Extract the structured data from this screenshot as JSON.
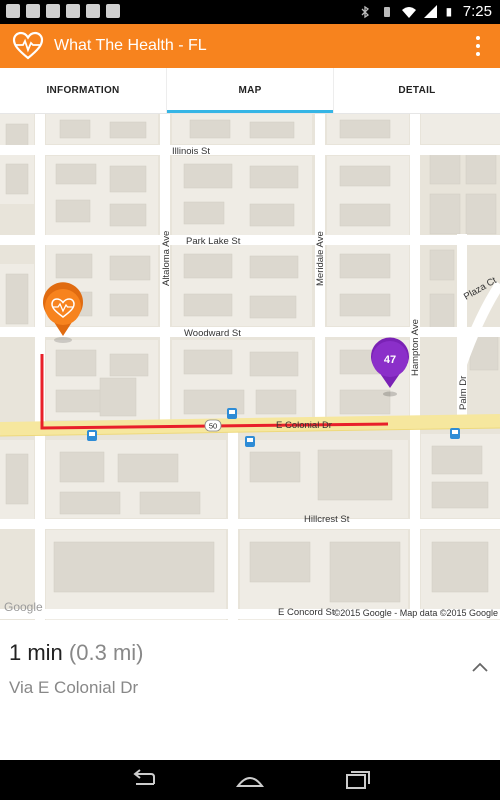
{
  "status_bar": {
    "time": "7:25"
  },
  "app_bar": {
    "title": "What The Health - FL"
  },
  "tabs": [
    {
      "label": "INFORMATION",
      "active": false
    },
    {
      "label": "MAP",
      "active": true
    },
    {
      "label": "DETAIL",
      "active": false
    }
  ],
  "map": {
    "streets": {
      "illinois": "Illinois St",
      "park_lake": "Park Lake St",
      "woodward": "Woodward St",
      "colonial": "E Colonial Dr",
      "hillcrest": "Hillcrest St",
      "concord": "E Concord St",
      "altaloma": "Altaloma Ave",
      "meridale": "Meridale Ave",
      "hampton": "Hampton Ave",
      "palm": "Palm Dr",
      "plaza": "Plaza Ct"
    },
    "route_shield": "50",
    "marker_count": "47",
    "credit": "©2015 Google - Map data ©2015 Google",
    "logo": "Google",
    "colors": {
      "route": "#e8202a",
      "origin_marker": "#f7831e",
      "cluster_marker": "#8b2fc9",
      "major_road": "#f6e79e"
    }
  },
  "route": {
    "time": "1 min",
    "distance": "(0.3 mi)",
    "via": "Via E Colonial Dr"
  },
  "colors": {
    "accent": "#f7831e",
    "tab_indicator": "#35b5e5"
  }
}
